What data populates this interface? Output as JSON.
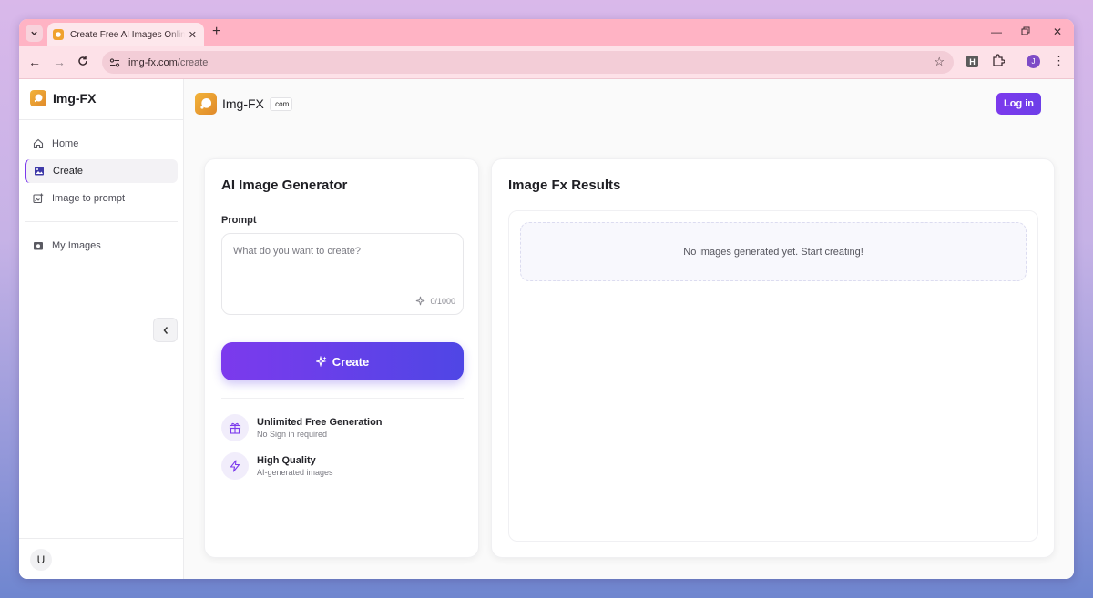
{
  "browser": {
    "tab_title": "Create Free AI Images Online W",
    "url_domain": "img-fx.com",
    "url_path": "/create",
    "profile_initial": "J",
    "extension_label": "H"
  },
  "sidebar": {
    "brand": "Img-FX",
    "items": [
      {
        "label": "Home",
        "icon": "home-icon",
        "active": false
      },
      {
        "label": "Create",
        "icon": "image-icon",
        "active": true
      },
      {
        "label": "Image to prompt",
        "icon": "image-add-icon",
        "active": false
      },
      {
        "label": "My Images",
        "icon": "camera-icon",
        "active": false
      }
    ],
    "user_initial": "U"
  },
  "header": {
    "brand": "Img-FX",
    "badge": ".com",
    "login_label": "Log in"
  },
  "generator": {
    "title": "AI Image Generator",
    "prompt_label": "Prompt",
    "prompt_placeholder": "What do you want to create?",
    "prompt_value": "",
    "char_count": "0/1000",
    "create_label": "Create",
    "features": [
      {
        "title": "Unlimited Free Generation",
        "subtitle": "No Sign in required",
        "icon": "gift-icon"
      },
      {
        "title": "High Quality",
        "subtitle": "AI-generated images",
        "icon": "lightning-icon"
      }
    ]
  },
  "results": {
    "title": "Image Fx Results",
    "empty_message": "No images generated yet. Start creating!"
  },
  "colors": {
    "accent": "#7c3aed",
    "accent_end": "#4f46e5",
    "tab_strip": "#ffb3c4"
  }
}
